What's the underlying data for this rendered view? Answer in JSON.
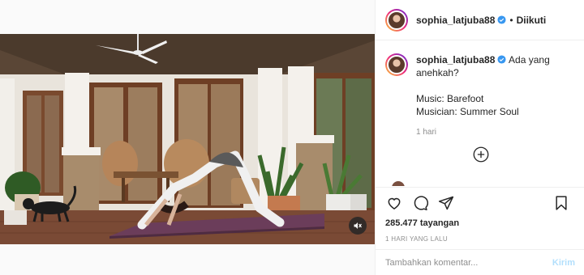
{
  "header": {
    "username": "sophia_latjuba88",
    "separator": "•",
    "follow_label": "Diikuti"
  },
  "caption": {
    "username": "sophia_latjuba88",
    "text": "Ada yang anehkah?",
    "music": "Music: Barefoot",
    "musician": "Musician: Summer Soul",
    "time": "1 hari"
  },
  "stats": {
    "views": "285.477 tayangan",
    "posted": "1 HARI YANG LALU"
  },
  "comment": {
    "placeholder": "Tambahkan komentar...",
    "post_label": "Kirim"
  },
  "colors": {
    "verified": "#3897f0",
    "post_disabled": "#b2dffc",
    "muted_text": "#8e8e8e"
  },
  "icons": {
    "mute": "speaker-muted-icon",
    "more": "plus-circle-icon",
    "like": "heart-icon",
    "comment": "comment-bubble-icon",
    "share": "paper-plane-icon",
    "save": "bookmark-icon"
  }
}
